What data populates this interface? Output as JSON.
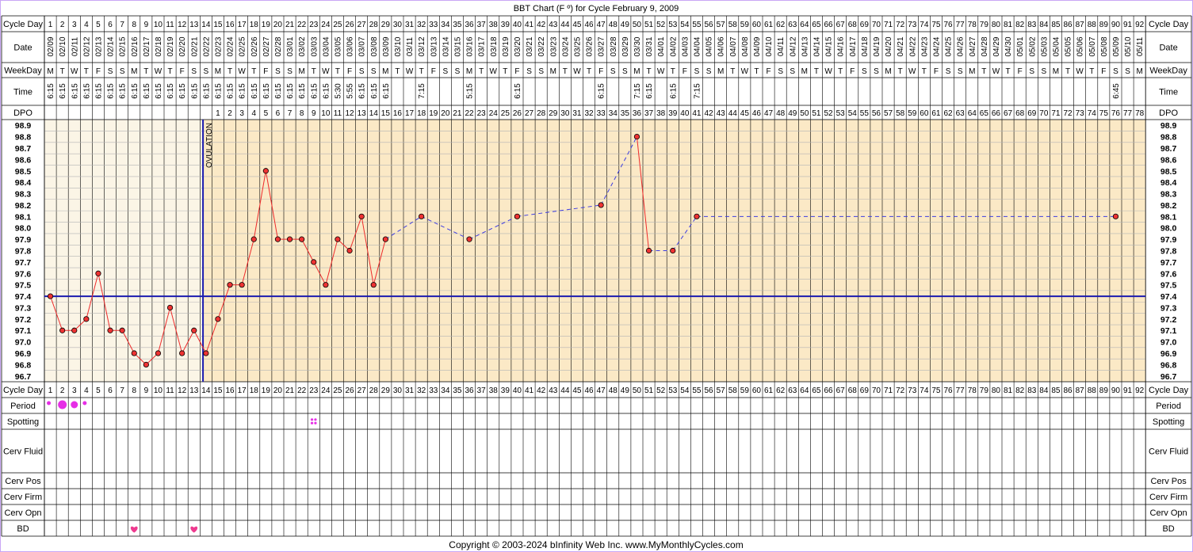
{
  "title": "BBT Chart (F º) for Cycle February 9, 2009",
  "copyright": "Copyright © 2003-2024 bInfinity Web Inc.      www.MyMonthlyCycles.com",
  "row_labels": {
    "cycle_day": "Cycle Day",
    "date": "Date",
    "weekday": "WeekDay",
    "time": "Time",
    "dpo": "DPO",
    "period": "Period",
    "spotting": "Spotting",
    "cerv_fluid": "Cerv Fluid",
    "cerv_pos": "Cerv Pos",
    "cerv_firm": "Cerv Firm",
    "cerv_opn": "Cerv Opn",
    "bd": "BD"
  },
  "ovulation_label": "OVULATION",
  "colors": {
    "background": "#ffffff",
    "frame": "#c9a6f5",
    "pre_ovulation_fill": "#fbf5e6",
    "post_ovulation_fill": "#fbe9c6",
    "grid": "#b4b4b4",
    "temp_line": "#ee2b2b",
    "temp_dot": "#ee3333",
    "coverline": "#1b1bb0",
    "period": "#e62ee6",
    "bd_heart": "#ee3a8f"
  },
  "chart_data": {
    "type": "line",
    "title": "BBT Chart (F º) for Cycle February 9, 2009",
    "ylim": [
      96.7,
      98.9
    ],
    "y_ticks": [
      "98.9",
      "98.8",
      "98.7",
      "98.6",
      "98.5",
      "98.4",
      "98.3",
      "98.2",
      "98.1",
      "98.0",
      "97.9",
      "97.8",
      "97.7",
      "97.6",
      "97.5",
      "97.4",
      "97.3",
      "97.2",
      "97.1",
      "97.0",
      "96.9",
      "96.8",
      "96.7"
    ],
    "cycle_days": [
      1,
      2,
      3,
      4,
      5,
      6,
      7,
      8,
      9,
      10,
      11,
      12,
      13,
      14,
      15,
      16,
      17,
      18,
      19,
      20,
      21,
      22,
      23,
      24,
      25,
      26,
      27,
      28,
      29,
      30,
      31,
      32,
      33,
      34,
      35,
      36,
      37,
      38,
      39,
      40,
      41,
      42,
      43,
      44,
      45,
      46,
      47,
      48,
      49,
      50,
      51,
      52,
      53,
      54,
      55,
      56,
      57,
      58,
      59,
      60,
      61,
      62,
      63,
      64,
      65,
      66,
      67,
      68,
      69,
      70,
      71,
      72,
      73,
      74,
      75,
      76,
      77,
      78,
      79,
      80,
      81,
      82,
      83,
      84,
      85,
      86,
      87,
      88,
      89,
      90,
      91,
      92
    ],
    "dates": [
      "02/09",
      "02/10",
      "02/11",
      "02/12",
      "02/13",
      "02/14",
      "02/15",
      "02/16",
      "02/17",
      "02/18",
      "02/19",
      "02/20",
      "02/21",
      "02/22",
      "02/23",
      "02/24",
      "02/25",
      "02/26",
      "02/27",
      "02/28",
      "03/01",
      "03/02",
      "03/03",
      "03/04",
      "03/05",
      "03/06",
      "03/07",
      "03/08",
      "03/09",
      "03/10",
      "03/11",
      "03/12",
      "03/13",
      "03/14",
      "03/15",
      "03/16",
      "03/17",
      "03/18",
      "03/19",
      "03/20",
      "03/21",
      "03/22",
      "03/23",
      "03/24",
      "03/25",
      "03/26",
      "03/27",
      "03/28",
      "03/29",
      "03/30",
      "03/31",
      "04/01",
      "04/02",
      "04/03",
      "04/04",
      "04/05",
      "04/06",
      "04/07",
      "04/08",
      "04/09",
      "04/10",
      "04/11",
      "04/12",
      "04/13",
      "04/14",
      "04/15",
      "04/16",
      "04/17",
      "04/18",
      "04/19",
      "04/20",
      "04/21",
      "04/22",
      "04/23",
      "04/24",
      "04/25",
      "04/26",
      "04/27",
      "04/28",
      "04/29",
      "04/30",
      "05/01",
      "05/02",
      "05/03",
      "05/04",
      "05/05",
      "05/06",
      "05/07",
      "05/08",
      "05/09",
      "05/10",
      "05/11"
    ],
    "weekdays": [
      "M",
      "T",
      "W",
      "T",
      "F",
      "S",
      "S",
      "M",
      "T",
      "W",
      "T",
      "F",
      "S",
      "S",
      "M",
      "T",
      "W",
      "T",
      "F",
      "S",
      "S",
      "M",
      "T",
      "W",
      "T",
      "F",
      "S",
      "S",
      "M",
      "T",
      "W",
      "T",
      "F",
      "S",
      "S",
      "M",
      "T",
      "W",
      "T",
      "F",
      "S",
      "S",
      "M",
      "T",
      "W",
      "T",
      "F",
      "S",
      "S",
      "M",
      "T",
      "W",
      "T",
      "F",
      "S",
      "S",
      "M",
      "T",
      "W",
      "T",
      "F",
      "S",
      "S",
      "M",
      "T",
      "W",
      "T",
      "F",
      "S",
      "S",
      "M",
      "T",
      "W",
      "T",
      "F",
      "S",
      "S",
      "M",
      "T",
      "W",
      "T",
      "F",
      "S",
      "S",
      "M",
      "T",
      "W",
      "T",
      "F",
      "S",
      "S",
      "M"
    ],
    "times": [
      "6:15",
      "6:15",
      "6:15",
      "6:15",
      "6:15",
      "6:15",
      "6:15",
      "6:15",
      "6:15",
      "6:15",
      "6:15",
      "6:15",
      "6:15",
      "6:15",
      "6:15",
      "6:15",
      "6:15",
      "6:15",
      "6:15",
      "6:15",
      "6:15",
      "6:15",
      "6:15",
      "6:15",
      "5:30",
      "5:55",
      "6:15",
      "6:15",
      "6:15",
      "",
      "",
      "7:15",
      "",
      "",
      "",
      "5:15",
      "",
      "",
      "",
      "6:15",
      "",
      "",
      "",
      "",
      "",
      "",
      "6:15",
      "",
      "",
      "7:15",
      "6:15",
      "",
      "6:15",
      "",
      "7:15",
      "",
      "",
      "",
      "",
      "",
      "",
      "",
      "",
      "",
      "",
      "",
      "",
      "",
      "",
      "",
      "",
      "",
      "",
      "",
      "",
      "",
      "",
      "",
      "",
      "",
      "",
      "",
      "",
      "",
      "",
      "",
      "",
      "",
      "",
      "6:45",
      "",
      ""
    ],
    "dpo": [
      "",
      "",
      "",
      "",
      "",
      "",
      "",
      "",
      "",
      "",
      "",
      "",
      "",
      "",
      "1",
      "2",
      "3",
      "4",
      "5",
      "6",
      "7",
      "8",
      "9",
      "10",
      "11",
      "12",
      "13",
      "14",
      "15",
      "16",
      "17",
      "18",
      "19",
      "20",
      "21",
      "22",
      "23",
      "24",
      "25",
      "26",
      "27",
      "28",
      "29",
      "30",
      "31",
      "32",
      "33",
      "34",
      "35",
      "36",
      "37",
      "38",
      "39",
      "40",
      "41",
      "42",
      "43",
      "44",
      "45",
      "46",
      "47",
      "48",
      "49",
      "50",
      "51",
      "52",
      "53",
      "54",
      "55",
      "56",
      "57",
      "58",
      "59",
      "60",
      "61",
      "62",
      "63",
      "64",
      "65",
      "66",
      "67",
      "68",
      "69",
      "70",
      "71",
      "72",
      "73",
      "74",
      "75",
      "76",
      "77",
      "78"
    ],
    "temperatures": [
      {
        "day": 1,
        "temp": 97.4
      },
      {
        "day": 2,
        "temp": 97.1
      },
      {
        "day": 3,
        "temp": 97.1
      },
      {
        "day": 4,
        "temp": 97.2
      },
      {
        "day": 5,
        "temp": 97.6
      },
      {
        "day": 6,
        "temp": 97.1
      },
      {
        "day": 7,
        "temp": 97.1
      },
      {
        "day": 8,
        "temp": 96.9
      },
      {
        "day": 9,
        "temp": 96.8
      },
      {
        "day": 10,
        "temp": 96.9
      },
      {
        "day": 11,
        "temp": 97.3
      },
      {
        "day": 12,
        "temp": 96.9
      },
      {
        "day": 13,
        "temp": 97.1
      },
      {
        "day": 14,
        "temp": 96.9
      },
      {
        "day": 15,
        "temp": 97.2
      },
      {
        "day": 16,
        "temp": 97.5
      },
      {
        "day": 17,
        "temp": 97.5
      },
      {
        "day": 18,
        "temp": 97.9
      },
      {
        "day": 19,
        "temp": 98.5
      },
      {
        "day": 20,
        "temp": 97.9
      },
      {
        "day": 21,
        "temp": 97.9
      },
      {
        "day": 22,
        "temp": 97.9
      },
      {
        "day": 23,
        "temp": 97.7
      },
      {
        "day": 24,
        "temp": 97.5
      },
      {
        "day": 25,
        "temp": 97.9
      },
      {
        "day": 26,
        "temp": 97.8
      },
      {
        "day": 27,
        "temp": 98.1
      },
      {
        "day": 28,
        "temp": 97.5
      },
      {
        "day": 29,
        "temp": 97.9
      },
      {
        "day": 32,
        "temp": 98.1
      },
      {
        "day": 36,
        "temp": 97.9
      },
      {
        "day": 40,
        "temp": 98.1
      },
      {
        "day": 47,
        "temp": 98.2
      },
      {
        "day": 50,
        "temp": 98.8
      },
      {
        "day": 51,
        "temp": 97.8
      },
      {
        "day": 53,
        "temp": 97.8
      },
      {
        "day": 55,
        "temp": 98.1
      },
      {
        "day": 90,
        "temp": 98.1
      }
    ],
    "coverline": 97.4,
    "ovulation_day": 14,
    "period": [
      {
        "day": 1,
        "flow": "spotting"
      },
      {
        "day": 2,
        "flow": "heavy"
      },
      {
        "day": 3,
        "flow": "medium"
      },
      {
        "day": 4,
        "flow": "spotting"
      }
    ],
    "spotting_days": [
      23
    ],
    "bd_days": [
      8,
      13
    ]
  }
}
